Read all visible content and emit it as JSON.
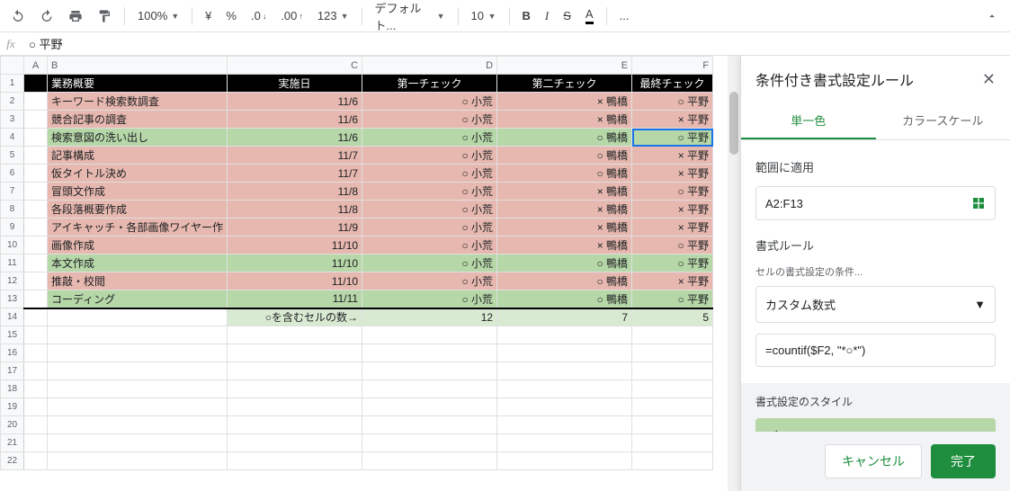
{
  "toolbar": {
    "zoom": "100%",
    "currency": "¥",
    "percent": "%",
    "dec_dec": ".0",
    "dec_inc": ".00",
    "num_fmt": "123",
    "font": "デフォルト...",
    "size": "10",
    "more": "..."
  },
  "fx": {
    "value": "○ 平野"
  },
  "columns": [
    "A",
    "B",
    "C",
    "D",
    "E",
    "F"
  ],
  "header_row": [
    "",
    "業務概要",
    "実施日",
    "第一チェック",
    "第二チェック",
    "最終チェック"
  ],
  "rows": [
    {
      "n": 2,
      "cls": "red",
      "c": [
        "",
        "キーワード検索数調査",
        "11/6",
        "○ 小荒",
        "× 鴨橋",
        "○ 平野"
      ]
    },
    {
      "n": 3,
      "cls": "red",
      "c": [
        "",
        "競合記事の調査",
        "11/6",
        "○ 小荒",
        "× 鴨橋",
        "× 平野"
      ]
    },
    {
      "n": 4,
      "cls": "grn",
      "c": [
        "",
        "検索意図の洗い出し",
        "11/6",
        "○ 小荒",
        "○ 鴨橋",
        "○ 平野"
      ],
      "active": 5
    },
    {
      "n": 5,
      "cls": "red",
      "c": [
        "",
        "記事構成",
        "11/7",
        "○ 小荒",
        "○ 鴨橋",
        "× 平野"
      ]
    },
    {
      "n": 6,
      "cls": "red",
      "c": [
        "",
        "仮タイトル決め",
        "11/7",
        "○ 小荒",
        "○ 鴨橋",
        "× 平野"
      ]
    },
    {
      "n": 7,
      "cls": "red",
      "c": [
        "",
        "冒頭文作成",
        "11/8",
        "○ 小荒",
        "× 鴨橋",
        "○ 平野"
      ]
    },
    {
      "n": 8,
      "cls": "red",
      "c": [
        "",
        "各段落概要作成",
        "11/8",
        "○ 小荒",
        "× 鴨橋",
        "× 平野"
      ]
    },
    {
      "n": 9,
      "cls": "red",
      "c": [
        "",
        "アイキャッチ・各部画像ワイヤー作",
        "11/9",
        "○ 小荒",
        "× 鴨橋",
        "× 平野"
      ]
    },
    {
      "n": 10,
      "cls": "red",
      "c": [
        "",
        "画像作成",
        "11/10",
        "○ 小荒",
        "× 鴨橋",
        "○ 平野"
      ]
    },
    {
      "n": 11,
      "cls": "grn",
      "c": [
        "",
        "本文作成",
        "11/10",
        "○ 小荒",
        "○ 鴨橋",
        "○ 平野"
      ]
    },
    {
      "n": 12,
      "cls": "red",
      "c": [
        "",
        "推敲・校閲",
        "11/10",
        "○ 小荒",
        "○ 鴨橋",
        "× 平野"
      ]
    },
    {
      "n": 13,
      "cls": "grn",
      "c": [
        "",
        "コーディング",
        "11/11",
        "○ 小荒",
        "○ 鴨橋",
        "○ 平野"
      ]
    }
  ],
  "sum_row": {
    "n": 14,
    "c": [
      "",
      "",
      "○を含むセルの数→",
      "12",
      "7",
      "5"
    ]
  },
  "empty_rows": [
    15,
    16,
    17,
    18,
    19,
    20,
    21,
    22
  ],
  "sidebar": {
    "title": "条件付き書式設定ルール",
    "tab_single": "単一色",
    "tab_scale": "カラースケール",
    "range_label": "範囲に適用",
    "range_value": "A2:F13",
    "rule_label": "書式ルール",
    "condition_label": "セルの書式設定の条件...",
    "condition_value": "カスタム数式",
    "formula": "=countif($F2, \"*○*\")",
    "style_label": "書式設定のスタイル",
    "style_preview": "デフォルト",
    "cancel": "キャンセル",
    "done": "完了"
  }
}
